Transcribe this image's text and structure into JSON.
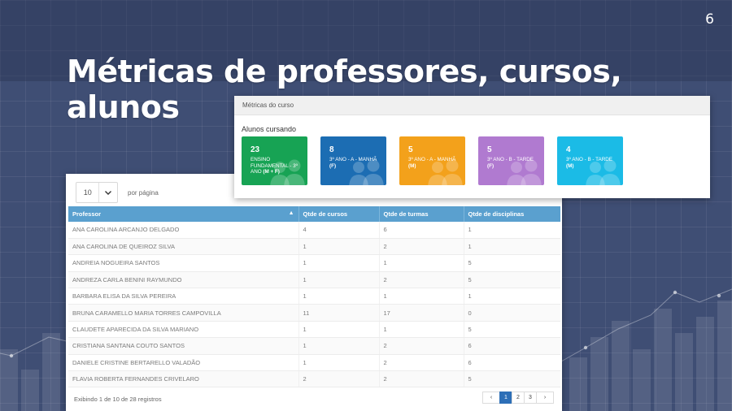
{
  "slide": {
    "page_number": "6",
    "title": "Métricas de professores, cursos, alunos"
  },
  "metrics": {
    "header": "Métricas do curso",
    "subtitle": "Alunos cursando",
    "cards": [
      {
        "count": "23",
        "label": "ENSINO FUNDAMENTAL - 3º ANO",
        "suffix": "(M + F)",
        "color": "#17a354",
        "icon": "users-icon"
      },
      {
        "count": "8",
        "label": "3º ANO - A - MANHÃ",
        "suffix": "(F)",
        "color": "#1c6db3",
        "icon": "users-icon"
      },
      {
        "count": "5",
        "label": "3º ANO - A - MANHÃ",
        "suffix": "(M)",
        "color": "#f3a11b",
        "icon": "users-icon"
      },
      {
        "count": "5",
        "label": "3º ANO - B - TARDE",
        "suffix": "(F)",
        "color": "#b07ad0",
        "icon": "users-icon"
      },
      {
        "count": "4",
        "label": "3º ANO - B - TARDE",
        "suffix": "(M)",
        "color": "#1bbbe6",
        "icon": "users-icon"
      }
    ]
  },
  "table": {
    "per_page_value": "10",
    "per_page_label": "por página",
    "columns": [
      "Professor",
      "Qtde de cursos",
      "Qtde de turmas",
      "Qtde de disciplinas"
    ],
    "rows": [
      [
        "ANA CAROLINA ARCANJO DELGADO",
        "4",
        "6",
        "1"
      ],
      [
        "ANA CAROLINA DE QUEIROZ SILVA",
        "1",
        "2",
        "1"
      ],
      [
        "ANDREIA NOGUEIRA SANTOS",
        "1",
        "1",
        "5"
      ],
      [
        "ANDREZA CARLA BENINI RAYMUNDO",
        "1",
        "2",
        "5"
      ],
      [
        "BARBARA ELISA DA SILVA PEREIRA",
        "1",
        "1",
        "1"
      ],
      [
        "BRUNA CARAMELLO MARIA TORRES CAMPOVILLA",
        "11",
        "17",
        "0"
      ],
      [
        "CLAUDETE APARECIDA DA SILVA MARIANO",
        "1",
        "1",
        "5"
      ],
      [
        "CRISTIANA SANTANA COUTO SANTOS",
        "1",
        "2",
        "6"
      ],
      [
        "DANIELE CRISTINE BERTARELLO VALADÃO",
        "1",
        "2",
        "6"
      ],
      [
        "FLAVIA ROBERTA FERNANDES CRIVELARO",
        "2",
        "2",
        "5"
      ]
    ],
    "footer": "Exibindo 1 de 10 de 28 registros",
    "pagination": {
      "prev": "‹",
      "pages": [
        "1",
        "2",
        "3"
      ],
      "active": "1",
      "next": "›"
    }
  },
  "colors": {
    "background": "#3f4e74",
    "table_header": "#5aa0cf",
    "pagination_active": "#2d6fb7"
  }
}
